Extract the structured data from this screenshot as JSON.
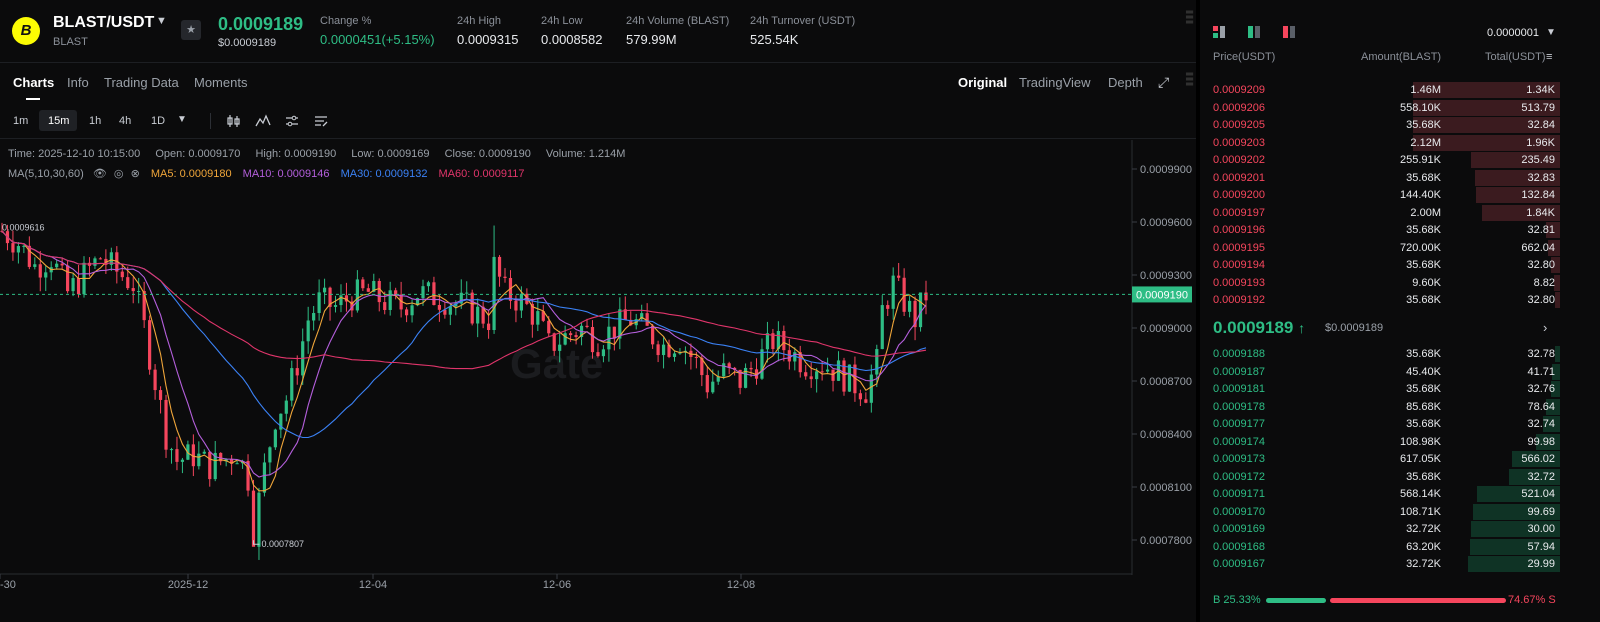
{
  "header": {
    "pair": "BLAST/USDT",
    "base": "BLAST",
    "last_price": "0.0009189",
    "last_price_usd": "$0.0009189",
    "stats": [
      {
        "label": "Change %",
        "value": "0.0000451(+5.15%)",
        "tone": "green"
      },
      {
        "label": "24h High",
        "value": "0.0009315"
      },
      {
        "label": "24h Low",
        "value": "0.0008582"
      },
      {
        "label": "24h Volume (BLAST)",
        "value": "579.99M"
      },
      {
        "label": "24h Turnover (USDT)",
        "value": "525.54K"
      }
    ]
  },
  "tabs": {
    "left": [
      "Charts",
      "Info",
      "Trading Data",
      "Moments"
    ],
    "right": [
      "Original",
      "TradingView",
      "Depth"
    ],
    "active_left": "Charts",
    "active_right": "Original"
  },
  "intervals": {
    "items": [
      "1m",
      "15m",
      "1h",
      "4h",
      "1D"
    ],
    "active": "15m"
  },
  "legend": {
    "time": "Time: 2025-12-10 10:15:00",
    "open": "Open: 0.0009170",
    "high": "High: 0.0009190",
    "low": "Low: 0.0009169",
    "close": "Close: 0.0009190",
    "volume": "Volume: 1.214M",
    "ma_label": "MA(5,10,30,60)",
    "ma5": "MA5: 0.0009180",
    "ma10": "MA10: 0.0009146",
    "ma30": "MA30: 0.0009132",
    "ma60": "MA60: 0.0009117"
  },
  "colors": {
    "up": "#2ebd85",
    "down": "#f6465d",
    "ma5": "#f0a63a",
    "ma10": "#b45fdc",
    "ma30": "#3b82f6",
    "ma60": "#e0356b"
  },
  "chart_data": {
    "type": "candlestick",
    "y_ticks": [
      "0.0009900",
      "0.0009600",
      "0.0009300",
      "0.0009000",
      "0.0008700",
      "0.0008400",
      "0.0008100",
      "0.0007800"
    ],
    "y_range": [
      0.00076,
      0.001
    ],
    "x_ticks": [
      "-30",
      "2025-12",
      "12-04",
      "12-06",
      "12-08"
    ],
    "current_price": "0.0009190",
    "high_marker": "0.0009616",
    "low_marker": "0.0007807",
    "close_path": [
      [
        0,
        0.000955
      ],
      [
        3,
        0.000948
      ],
      [
        6,
        0.000935
      ],
      [
        9,
        0.00094
      ],
      [
        12,
        0.00092
      ],
      [
        15,
        0.00093
      ],
      [
        18,
        0.00094
      ],
      [
        21,
        0.000932
      ],
      [
        24,
        0.000925
      ],
      [
        26,
        0.0009
      ],
      [
        28,
        0.00087
      ],
      [
        30,
        0.00084
      ],
      [
        32,
        0.000825
      ],
      [
        35,
        0.000828
      ],
      [
        38,
        0.000822
      ],
      [
        41,
        0.000826
      ],
      [
        43,
        0.00083
      ],
      [
        45,
        0.000815
      ],
      [
        46,
        0.000785
      ],
      [
        48,
        0.00082
      ],
      [
        50,
        0.00085
      ],
      [
        52,
        0.00086
      ],
      [
        54,
        0.00088
      ],
      [
        56,
        0.000905
      ],
      [
        58,
        0.000915
      ],
      [
        61,
        0.000912
      ],
      [
        64,
        0.000918
      ],
      [
        67,
        0.00092
      ],
      [
        70,
        0.000915
      ],
      [
        73,
        0.000912
      ],
      [
        76,
        0.00092
      ],
      [
        79,
        0.000918
      ],
      [
        82,
        0.000915
      ],
      [
        85,
        0.000912
      ],
      [
        87,
        0.000908
      ],
      [
        89,
        0.000905
      ],
      [
        90,
        0.000935
      ],
      [
        92,
        0.00092
      ],
      [
        95,
        0.000915
      ],
      [
        98,
        0.000905
      ],
      [
        100,
        0.00089
      ],
      [
        103,
        0.000895
      ],
      [
        106,
        0.0009
      ],
      [
        109,
        0.000893
      ],
      [
        112,
        0.0009
      ],
      [
        115,
        0.000905
      ],
      [
        118,
        0.000898
      ],
      [
        121,
        0.00089
      ],
      [
        124,
        0.000893
      ],
      [
        127,
        0.00088
      ],
      [
        129,
        0.000868
      ],
      [
        132,
        0.000875
      ],
      [
        135,
        0.00087
      ],
      [
        138,
        0.00088
      ],
      [
        141,
        0.000893
      ],
      [
        144,
        0.000887
      ],
      [
        147,
        0.00088
      ],
      [
        150,
        0.00088
      ],
      [
        153,
        0.000875
      ],
      [
        156,
        0.000868
      ],
      [
        158,
        0.000865
      ],
      [
        160,
        0.00088
      ],
      [
        161,
        0.00091
      ],
      [
        163,
        0.000925
      ],
      [
        165,
        0.000915
      ],
      [
        167,
        0.000905
      ],
      [
        169,
        0.000919
      ]
    ],
    "n_bars": 170
  },
  "orderbook": {
    "precision": "0.0000001",
    "headers": {
      "price": "Price(USDT)",
      "amount": "Amount(BLAST)",
      "total": "Total(USDT)"
    },
    "asks": [
      {
        "price": "0.0009209",
        "amount": "1.46M",
        "total": "1.34K",
        "depth": 0.98
      },
      {
        "price": "0.0009206",
        "amount": "558.10K",
        "total": "513.79",
        "depth": 0.98
      },
      {
        "price": "0.0009205",
        "amount": "35.68K",
        "total": "32.84",
        "depth": 0.98
      },
      {
        "price": "0.0009203",
        "amount": "2.12M",
        "total": "1.96K",
        "depth": 0.98
      },
      {
        "price": "0.0009202",
        "amount": "255.91K",
        "total": "235.49",
        "depth": 0.59
      },
      {
        "price": "0.0009201",
        "amount": "35.68K",
        "total": "32.83",
        "depth": 0.57
      },
      {
        "price": "0.0009200",
        "amount": "144.40K",
        "total": "132.84",
        "depth": 0.56
      },
      {
        "price": "0.0009197",
        "amount": "2.00M",
        "total": "1.84K",
        "depth": 0.52
      },
      {
        "price": "0.0009196",
        "amount": "35.68K",
        "total": "32.81",
        "depth": 0.09
      },
      {
        "price": "0.0009195",
        "amount": "720.00K",
        "total": "662.04",
        "depth": 0.08
      },
      {
        "price": "0.0009194",
        "amount": "35.68K",
        "total": "32.80",
        "depth": 0.06
      },
      {
        "price": "0.0009193",
        "amount": "9.60K",
        "total": "8.82",
        "depth": 0.04
      },
      {
        "price": "0.0009192",
        "amount": "35.68K",
        "total": "32.80",
        "depth": 0.03
      }
    ],
    "mid_price": "0.0009189",
    "mid_arrow": "↑",
    "mid_usd": "$0.0009189",
    "bids": [
      {
        "price": "0.0009188",
        "amount": "35.68K",
        "total": "32.78",
        "depth": 0.03
      },
      {
        "price": "0.0009187",
        "amount": "45.40K",
        "total": "41.71",
        "depth": 0.05
      },
      {
        "price": "0.0009181",
        "amount": "35.68K",
        "total": "32.76",
        "depth": 0.06
      },
      {
        "price": "0.0009178",
        "amount": "85.68K",
        "total": "78.64",
        "depth": 0.09
      },
      {
        "price": "0.0009177",
        "amount": "35.68K",
        "total": "32.74",
        "depth": 0.11
      },
      {
        "price": "0.0009174",
        "amount": "108.98K",
        "total": "99.98",
        "depth": 0.16
      },
      {
        "price": "0.0009173",
        "amount": "617.05K",
        "total": "566.02",
        "depth": 0.32
      },
      {
        "price": "0.0009172",
        "amount": "35.68K",
        "total": "32.72",
        "depth": 0.34
      },
      {
        "price": "0.0009171",
        "amount": "568.14K",
        "total": "521.04",
        "depth": 0.55
      },
      {
        "price": "0.0009170",
        "amount": "108.71K",
        "total": "99.69",
        "depth": 0.58
      },
      {
        "price": "0.0009169",
        "amount": "32.72K",
        "total": "30.00",
        "depth": 0.59
      },
      {
        "price": "0.0009168",
        "amount": "63.20K",
        "total": "57.94",
        "depth": 0.6
      },
      {
        "price": "0.0009167",
        "amount": "32.72K",
        "total": "29.99",
        "depth": 0.61
      }
    ],
    "buy_ratio": "B 25.33%",
    "sell_ratio": "74.67% S",
    "buy_pct": 25.33
  }
}
